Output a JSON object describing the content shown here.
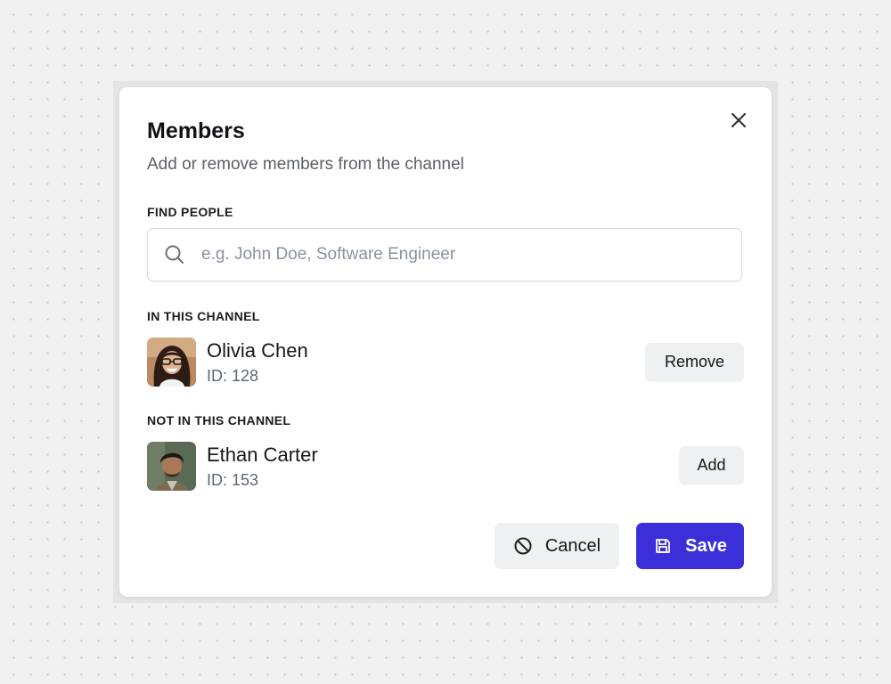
{
  "dialog": {
    "title": "Members",
    "subtitle": "Add or remove members from the channel",
    "close_icon": "close-icon"
  },
  "search": {
    "label": "FIND PEOPLE",
    "placeholder": "e.g. John Doe, Software Engineer",
    "value": "",
    "icon": "search-icon"
  },
  "in_channel": {
    "label": "IN THIS CHANNEL",
    "members": [
      {
        "name": "Olivia Chen",
        "id": "ID: 128",
        "action": "Remove"
      }
    ]
  },
  "not_in_channel": {
    "label": "NOT IN THIS CHANNEL",
    "members": [
      {
        "name": "Ethan Carter",
        "id": "ID: 153",
        "action": "Add"
      }
    ]
  },
  "footer": {
    "cancel_label": "Cancel",
    "cancel_icon": "ban-icon",
    "save_label": "Save",
    "save_icon": "floppy-disk-icon"
  },
  "colors": {
    "primary": "#3b2fd9",
    "secondary_button": "#eff0f2",
    "muted_text": "#5d6575",
    "placeholder": "#8a92a0"
  }
}
